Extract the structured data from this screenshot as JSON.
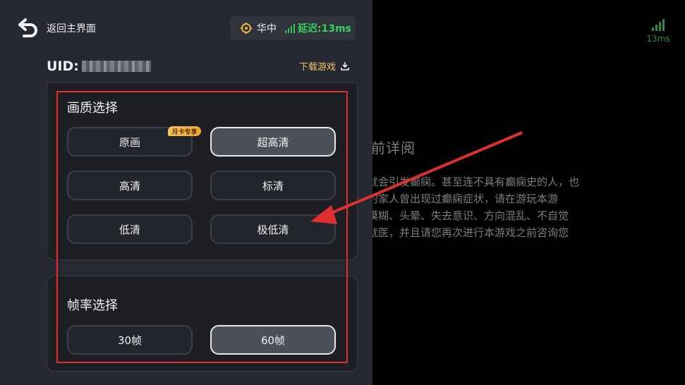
{
  "header": {
    "back_label": "返回主界面",
    "region": "华中",
    "latency": "延迟:13ms",
    "uid_label": "UID:",
    "download_label": "下载游戏"
  },
  "quality": {
    "title": "画质选择",
    "badge": "月卡专享",
    "options": [
      "原画",
      "超高清",
      "高清",
      "标清",
      "低清",
      "极低清"
    ],
    "selected": "超高清"
  },
  "fps": {
    "title": "帧率选择",
    "options": [
      "30帧",
      "60帧"
    ],
    "selected": "60帧"
  },
  "background": {
    "title": "戏前详阅",
    "lines": [
      "，就会引发癫痫。甚至连不具有癫痫史的人，也",
      "您的家人曾出现过癫痫症状，请在游玩本游",
      "视模糊、头晕、失去意识、方向混乱、不自觉",
      "即就医，并且请您再次进行本游戏之前咨询您"
    ],
    "latency_label": "13ms"
  },
  "colors": {
    "accent_green": "#36d35e",
    "accent_gold": "#f3c86a",
    "highlight_red": "#e02f2f",
    "panel_bg": "#252830"
  },
  "icons": {
    "back": "back-arrow-icon",
    "location": "location-pin-icon",
    "signal": "signal-bars-icon",
    "download": "download-icon"
  }
}
